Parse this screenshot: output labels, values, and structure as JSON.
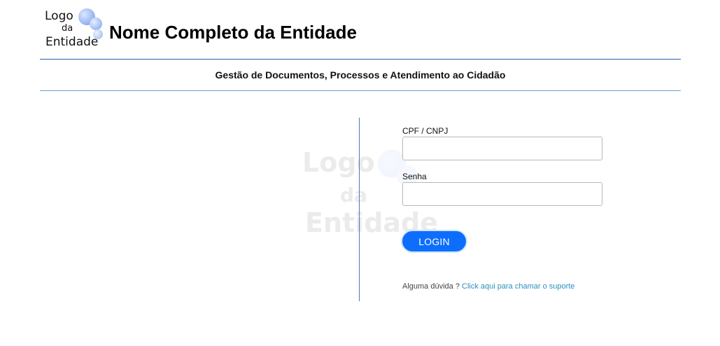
{
  "header": {
    "logo": {
      "line1": "Logo",
      "line2": "da",
      "line3": "Entidade"
    },
    "entity_name": "Nome Completo da Entidade",
    "subtitle": "Gestão de Documentos, Processos e Atendimento ao Cidadão"
  },
  "watermark": {
    "line1": "Logo",
    "line2": "da",
    "line3": "Entidade"
  },
  "form": {
    "cpf_label": "CPF / CNPJ",
    "cpf_value": "",
    "password_label": "Senha",
    "password_value": "",
    "login_label": "LOGIN"
  },
  "help": {
    "question": "Alguma dúvida ?",
    "link_text": "Click aqui para chamar o suporte"
  },
  "colors": {
    "primary": "#0d6efd",
    "rule": "#2d5fb3",
    "link": "#2b8fbf"
  }
}
